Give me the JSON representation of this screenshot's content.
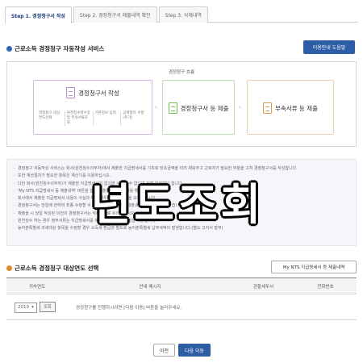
{
  "tabs": [
    "Step 1. 경정청구서 작성",
    "Step 2. 경정청구서 제출내역 확인",
    "Step 3. 삭제내역"
  ],
  "section1": {
    "title": "근로소득 경정청구 자동작성 서비스",
    "help_button": "이용안내 도움말"
  },
  "flow": {
    "title": "경정청구 흐름",
    "step1": {
      "label": "경정청구서 작성",
      "substeps": [
        "경정청구 대상연도선택",
        "원천징수영수증 및 부속서류조회",
        "기본정보 입력",
        "공제항목 수정(추가)"
      ]
    },
    "step2": {
      "label": "경정청구서 등 제출"
    },
    "step3": {
      "label": "부속서류 등 제출"
    }
  },
  "notes": [
    "경정청구 자동작성 서비스는 회사(원천징수의무자)에서 제출한 지급명세서를 기초로 당초금액을 미리 채워주고 근로자가 필요한 부분을 고쳐 경정청구서를 작성합니다.",
    "또한 계산절차가 필요한 항목은 계산기를 이용하십시오.",
    "다만 회사(원천징수의무자)가 제출한 지급명세서가 없으면 사용할 수 없으며 직접 입력해야 합니다.",
    "'My NTS 지급명세서 등 제출내역' 버튼을 눌러 제출된 지급명세서를 확인할 수 있습니다.",
    "회사에서 제출한 지급명세서 내용이 사실과 다른 경우 회사에 정정을 요청하십시오.",
    "경정청구서는 당일에 한하여 최종 수정할 수 있으며, 제출 후에는 제출내역에서 확인할 수 있습니다.",
    "제출을 시 당일 작성된 이전의 경정청구서는 삭제되므로 유의하십시오.",
    "원천징수 하는 경우 첨부서류는 지급명세서를 제출한 소득 외의 증빙을 제출합니다.",
    "농어촌특별세 과세대상 항목을 수정할 경우 소득세 환급과 별도로 농어촌특별세 납부세액이 발생합니다.(별도 고지서 발부)"
  ],
  "overlay_text": "년도조회",
  "section2": {
    "title": "근로소득 경정청구 대상연도 선택",
    "nts_button": "My NTS 지급명세서 등 제출내역"
  },
  "table": {
    "headers": [
      "귀속연도",
      "안내 메시지",
      "관할세무서",
      "전화번호"
    ],
    "year": "2019",
    "lookup_button": "조회",
    "message": "경정청구를 진행하시려면 [다음 이동] 버튼을 눌러주세요."
  },
  "nav": {
    "prev": "이전",
    "next": "다음 이동"
  }
}
